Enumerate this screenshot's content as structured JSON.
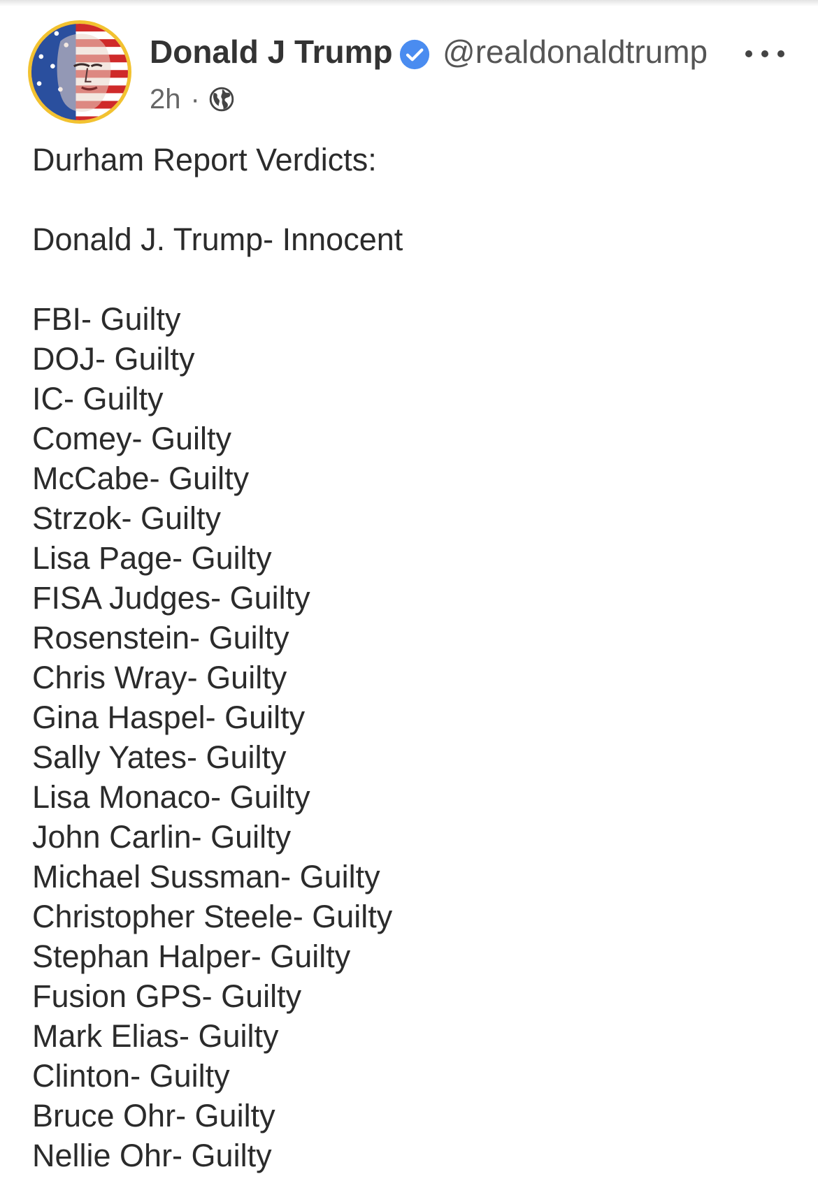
{
  "post": {
    "author": {
      "display_name": "Donald J Trump",
      "handle": "@realdonaldtrump",
      "verified": true,
      "avatar_icon": "flag-portrait-avatar"
    },
    "timestamp": "2h",
    "separator": "·",
    "visibility_icon": "globe-icon",
    "more_icon": "more-horizontal-icon",
    "title_line": "Durham Report Verdicts:",
    "headline_verdict": "Donald J. Trump- Innocent",
    "verdicts": [
      "FBI- Guilty",
      "DOJ- Guilty",
      "IC- Guilty",
      "Comey- Guilty",
      "McCabe- Guilty",
      "Strzok- Guilty",
      "Lisa Page- Guilty",
      "FISA Judges- Guilty",
      "Rosenstein- Guilty",
      "Chris Wray- Guilty",
      "Gina Haspel- Guilty",
      "Sally Yates- Guilty",
      "Lisa Monaco- Guilty",
      "John Carlin- Guilty",
      "Michael Sussman- Guilty",
      "Christopher Steele- Guilty",
      "Stephan Halper- Guilty",
      "Fusion GPS- Guilty",
      "Mark Elias- Guilty",
      "Clinton- Guilty",
      "Bruce Ohr- Guilty",
      "Nellie Ohr- Guilty"
    ]
  },
  "colors": {
    "verified_badge": "#4a8cf0",
    "avatar_ring": "#f2c230",
    "text": "#2b2b2b"
  }
}
